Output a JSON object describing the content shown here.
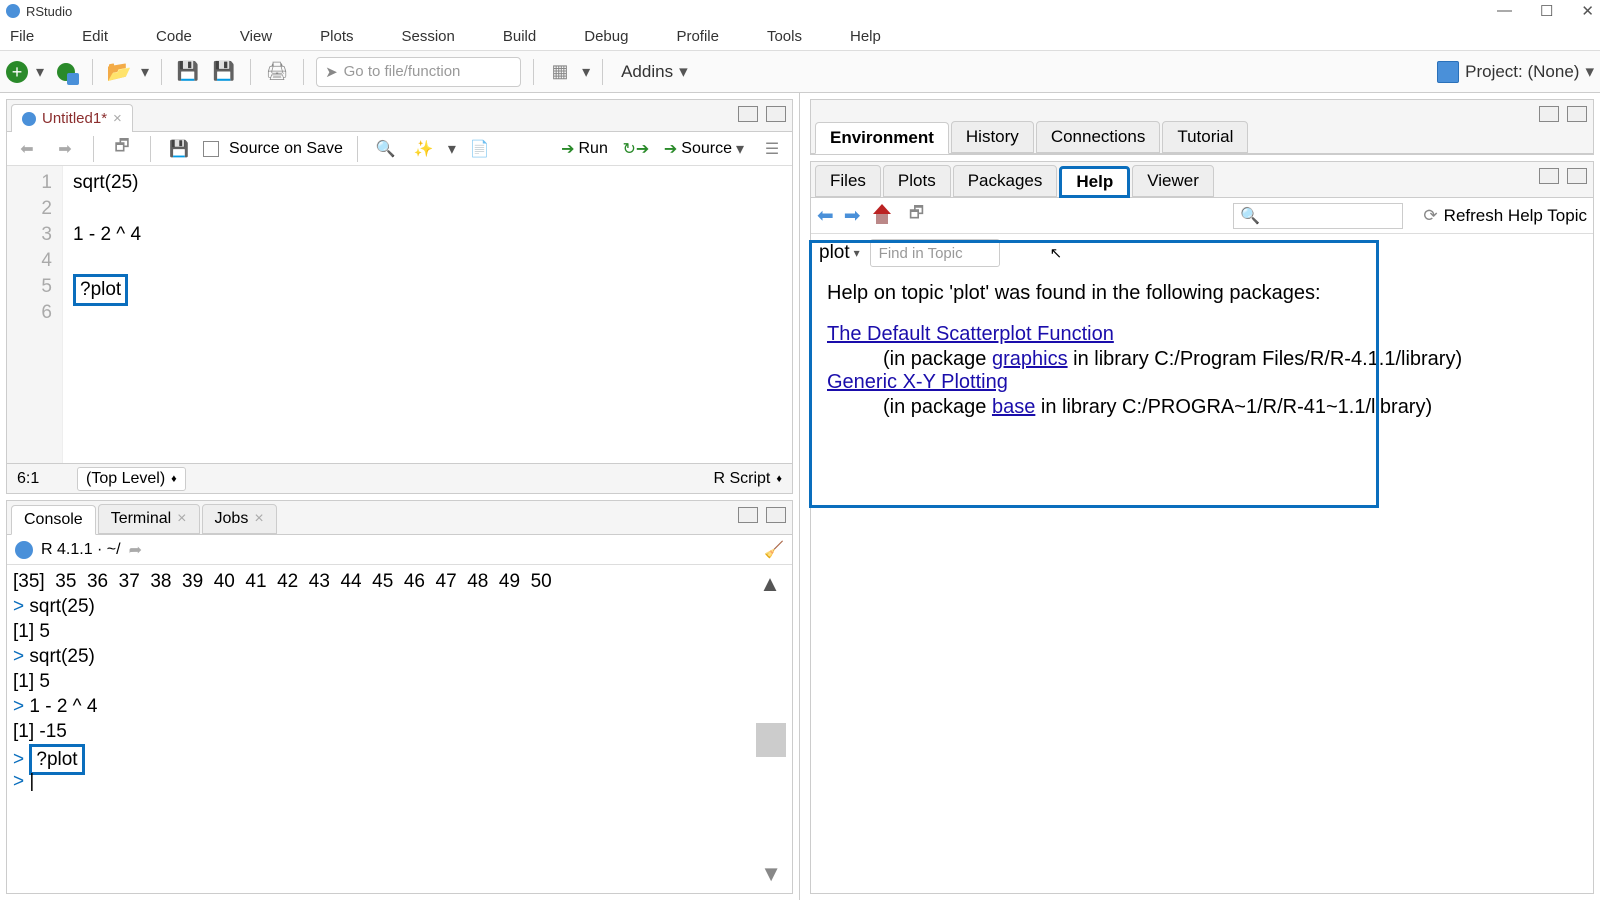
{
  "window": {
    "title": "RStudio"
  },
  "menu": [
    "File",
    "Edit",
    "Code",
    "View",
    "Plots",
    "Session",
    "Build",
    "Debug",
    "Profile",
    "Tools",
    "Help"
  ],
  "toolbar": {
    "goto_placeholder": "Go to file/function",
    "addins": "Addins",
    "project": "Project: (None)"
  },
  "source": {
    "tab": {
      "name": "Untitled1*",
      "icon": "r-icon"
    },
    "source_on_save": "Source on Save",
    "run": "Run",
    "source_btn": "Source",
    "lines": {
      "1": "sqrt(25)",
      "2": "",
      "3": "1 - 2 ^ 4",
      "4": "",
      "5": "?plot",
      "6": ""
    },
    "cursor_pos": "6:1",
    "scope": "(Top Level)",
    "lang": "R Script"
  },
  "console": {
    "tabs": {
      "console": "Console",
      "terminal": "Terminal",
      "jobs": "Jobs"
    },
    "info": "R 4.1.1 · ~/",
    "lines": [
      "[35]  35  36  37  38  39  40  41  42  43  44  45  46  47  48  49  50",
      "> sqrt(25)",
      "[1] 5",
      "> sqrt(25)",
      "[1] 5",
      "> 1 - 2 ^ 4",
      "[1] -15",
      "> ?plot",
      "> "
    ]
  },
  "env_tabs": [
    "Environment",
    "History",
    "Connections",
    "Tutorial"
  ],
  "help_tabs": [
    "Files",
    "Plots",
    "Packages",
    "Help",
    "Viewer"
  ],
  "help": {
    "refresh": "Refresh Help Topic",
    "topic": "plot",
    "find_placeholder": "Find in Topic",
    "heading": "Help on topic 'plot' was found in the following packages:",
    "link1": "The Default Scatterplot Function",
    "pkg1a": "(in package ",
    "pkg1_link": "graphics",
    "pkg1b": " in library C:/Program Files/R/R-4.1.1/library)",
    "link2": "Generic X-Y Plotting",
    "pkg2a": "(in package ",
    "pkg2_link": "base",
    "pkg2b": " in library C:/PROGRA~1/R/R-41~1.1/library)"
  }
}
